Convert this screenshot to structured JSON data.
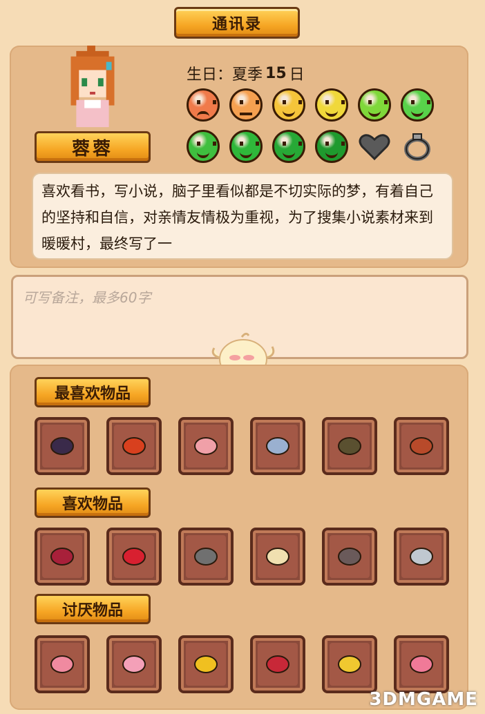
{
  "header": {
    "title": "通讯录"
  },
  "character": {
    "name": "蓉蓉",
    "birthday_label": "生日：夏季",
    "birthday_day": "15",
    "birthday_suffix": "日",
    "description": "喜欢看书，写小说，脑子里看似都是不切实际的梦，有着自己的坚持和自信，对亲情友情极为重视，为了搜集小说素材来到暖暖村，最终写了一"
  },
  "affection": {
    "row1": [
      {
        "icon": "frown-face-icon",
        "color": "#f07a4a"
      },
      {
        "icon": "neutral-face-icon",
        "color": "#f5a050"
      },
      {
        "icon": "smile-face-icon",
        "color": "#f5c43a"
      },
      {
        "icon": "smile-face-icon",
        "color": "#f0d83a"
      },
      {
        "icon": "happy-face-icon",
        "color": "#7fd83a"
      },
      {
        "icon": "happy-face-icon",
        "color": "#58d24a"
      }
    ],
    "row2": [
      {
        "icon": "happy-face-icon",
        "color": "#3fbf3f"
      },
      {
        "icon": "grin-face-icon",
        "color": "#2fb83a"
      },
      {
        "icon": "grin-face-icon",
        "color": "#27a936"
      },
      {
        "icon": "big-grin-face-icon",
        "color": "#1f9a2e"
      },
      {
        "icon": "heart-icon",
        "color": "#5a5a5a"
      },
      {
        "icon": "ring-icon",
        "color": "#6a6a6a"
      }
    ]
  },
  "note": {
    "placeholder": "可写备注，最多60字"
  },
  "sections": {
    "favorite": {
      "label": "最喜欢物品",
      "items": [
        "sea-cucumber-icon",
        "lobster-icon",
        "pink-fish-icon",
        "silver-fish-icon",
        "catfish-icon",
        "red-fish-icon"
      ]
    },
    "like": {
      "label": "喜欢物品",
      "items": [
        "red-gem-icon",
        "red-potion-icon",
        "dagger-icon",
        "treasure-bag-icon",
        "bat-icon",
        "steel-sword-icon"
      ]
    },
    "dislike": {
      "label": "讨厌物品",
      "items": [
        "pink-rose-icon",
        "pink-tulip-icon",
        "sunflower-icon",
        "red-rose-icon",
        "yellow-flower-icon",
        "pink-flowers-icon"
      ]
    }
  },
  "watermark": "3DMGAME"
}
